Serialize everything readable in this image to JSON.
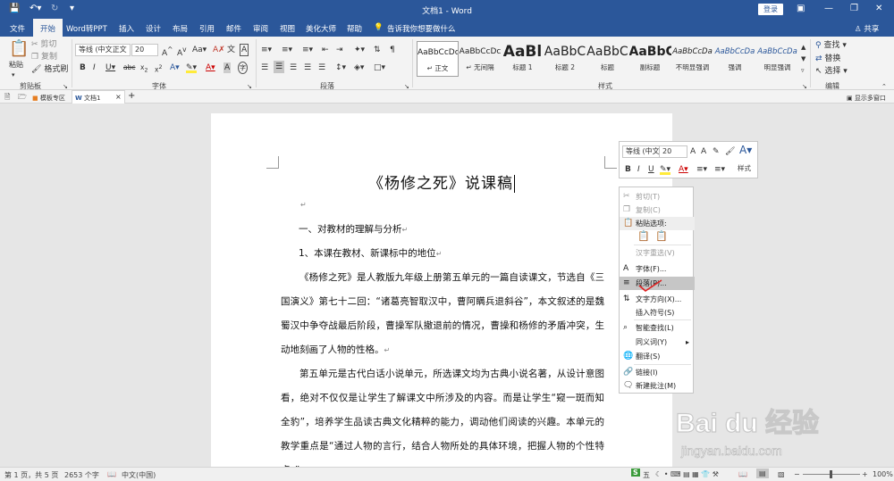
{
  "app": {
    "title": "文档1 - Word",
    "login": "登录",
    "share": "共享"
  },
  "menu": {
    "items": [
      "文件",
      "开始",
      "Word转PPT",
      "插入",
      "设计",
      "布局",
      "引用",
      "邮件",
      "审阅",
      "视图",
      "美化大师",
      "帮助"
    ],
    "tell_me": "告诉我你想要做什么"
  },
  "ribbon": {
    "clipboard": {
      "paste": "粘贴",
      "cut": "剪切",
      "copy": "复制",
      "format_painter": "格式刷",
      "label": "剪贴板"
    },
    "font": {
      "name": "等线 (中文正文",
      "size": "20",
      "label": "字体"
    },
    "paragraph": {
      "label": "段落"
    },
    "styles": {
      "label": "样式",
      "items": [
        {
          "sample": "AaBbCcDc",
          "name": "↵ 正文"
        },
        {
          "sample": "AaBbCcDc",
          "name": "↵ 无间隔"
        },
        {
          "sample": "AaBl",
          "name": "标题 1"
        },
        {
          "sample": "AaBbC",
          "name": "标题 2"
        },
        {
          "sample": "AaBbC",
          "name": "标题"
        },
        {
          "sample": "AaBbC",
          "name": "副标题"
        },
        {
          "sample": "AaBbCcDa",
          "name": "不明显强调"
        },
        {
          "sample": "AaBbCcDa",
          "name": "强调"
        },
        {
          "sample": "AaBbCcDa",
          "name": "明显强调"
        }
      ]
    },
    "editing": {
      "find": "查找",
      "replace": "替换",
      "select": "选择",
      "label": "编辑"
    }
  },
  "tabs": {
    "template": "模板专区",
    "doc": "文档1",
    "show_multi": "显示多窗口"
  },
  "document": {
    "title": "《杨修之死》说课稿",
    "paragraphs": [
      "一、对教材的理解与分析",
      "1、本课在教材、新课标中的地位",
      "《杨修之死》是人教版九年级上册第五单元的一篇自读课文，节选自《三国演义》第七十二回：“诸葛亮智取汉中，曹阿瞒兵退斜谷”，本文叙述的是魏蜀汉中争夺战最后阶段，曹操军队撤退前的情况，曹操和杨修的矛盾冲突，生动地刻画了人物的性格。",
      "第五单元是古代白话小说单元，所选课文均为古典小说名著，从设计意图看，绝对不仅仅是让学生了解课文中所涉及的内容。而是让学生“窥一斑而知全豹”，培养学生品读古典文化精粹的能力，调动他们阅读的兴趣。本单元的教学重点是“通过人物的言行，结合人物所处的具体环境，把握人物的个性特点。”"
    ]
  },
  "mini_toolbar": {
    "font": "等线 (中文",
    "size": "20",
    "styles_label": "样式"
  },
  "context_menu": {
    "items": [
      {
        "label": "剪切(T)",
        "icon": "scissors-icon",
        "disabled": true
      },
      {
        "label": "复制(C)",
        "icon": "copy-icon",
        "disabled": true
      },
      {
        "label": "粘贴选项:",
        "icon": "paste-icon",
        "disabled": false
      },
      {
        "label": "汉字重选(V)",
        "icon": "",
        "disabled": true
      },
      {
        "label": "字体(F)...",
        "icon": "font-icon",
        "disabled": false
      },
      {
        "label": "段落(P)...",
        "icon": "paragraph-icon",
        "disabled": false
      },
      {
        "label": "文字方向(X)...",
        "icon": "text-direction-icon",
        "disabled": false
      },
      {
        "label": "插入符号(S)",
        "icon": "",
        "disabled": false
      },
      {
        "label": "智能查找(L)",
        "icon": "search-icon",
        "disabled": false
      },
      {
        "label": "同义词(Y)",
        "icon": "",
        "disabled": false
      },
      {
        "label": "翻译(S)",
        "icon": "translate-icon",
        "disabled": false
      },
      {
        "label": "链接(I)",
        "icon": "link-icon",
        "disabled": false
      },
      {
        "label": "新建批注(M)",
        "icon": "comment-icon",
        "disabled": false
      }
    ]
  },
  "status": {
    "page": "第 1 页，共 5 页",
    "words": "2653 个字",
    "lang": "中文(中国)",
    "zoom": "100%",
    "ime": "五"
  },
  "watermark": {
    "brand": "Bai du 经验",
    "url": "jingyan.baidu.com"
  }
}
